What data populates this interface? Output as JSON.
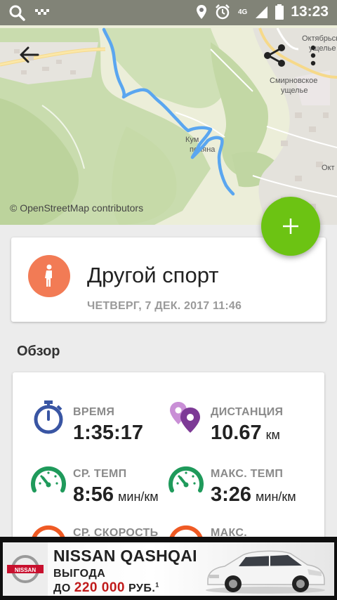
{
  "status_bar": {
    "time": "13:23",
    "network": "4G",
    "icons": [
      "search-icon",
      "taxi-icon",
      "location-icon",
      "alarm-icon",
      "signal-icon",
      "battery-icon"
    ]
  },
  "map": {
    "credit": "© OpenStreetMap contributors",
    "labels": {
      "top_right_1": "Октябрьск",
      "top_right_2": "ущелье",
      "right_1": "Смирновское",
      "right_2": "ущелье",
      "center_1": "Кум",
      "center_2": "поляна",
      "edge_right": "Окт"
    },
    "route_color": "#5aa6f0"
  },
  "toolbar": {
    "back_icon": "arrow-back-icon",
    "share_icon": "share-icon",
    "more_icon": "more-vert-icon"
  },
  "fab": {
    "icon": "plus-icon",
    "color": "#6cc313"
  },
  "activity": {
    "title": "Другой спорт",
    "date": "ЧЕТВЕРГ, 7 ДЕК. 2017 11:46",
    "icon": "walker-icon",
    "icon_color": "#f27b55"
  },
  "overview": {
    "title": "Обзор",
    "stats": {
      "time": {
        "label": "ВРЕМЯ",
        "value": "1:35:17",
        "unit": ""
      },
      "distance": {
        "label": "ДИСТАНЦИЯ",
        "value": "10.67",
        "unit": "км"
      },
      "avg_pace": {
        "label": "СР. ТЕМП",
        "value": "8:56",
        "unit": "мин/км"
      },
      "max_pace": {
        "label": "МАКС. ТЕМП",
        "value": "3:26",
        "unit": "мин/км"
      },
      "avg_speed": {
        "label": "СР. СКОРОСТЬ"
      },
      "max_speed": {
        "label": "МАКС."
      }
    }
  },
  "ad": {
    "brand": "NISSAN",
    "title": "NISSAN QASHQAI",
    "line2": "ВЫГОДА",
    "line3_prefix": "ДО",
    "amount": "220 000",
    "currency": "РУБ.",
    "footnote": "1"
  }
}
